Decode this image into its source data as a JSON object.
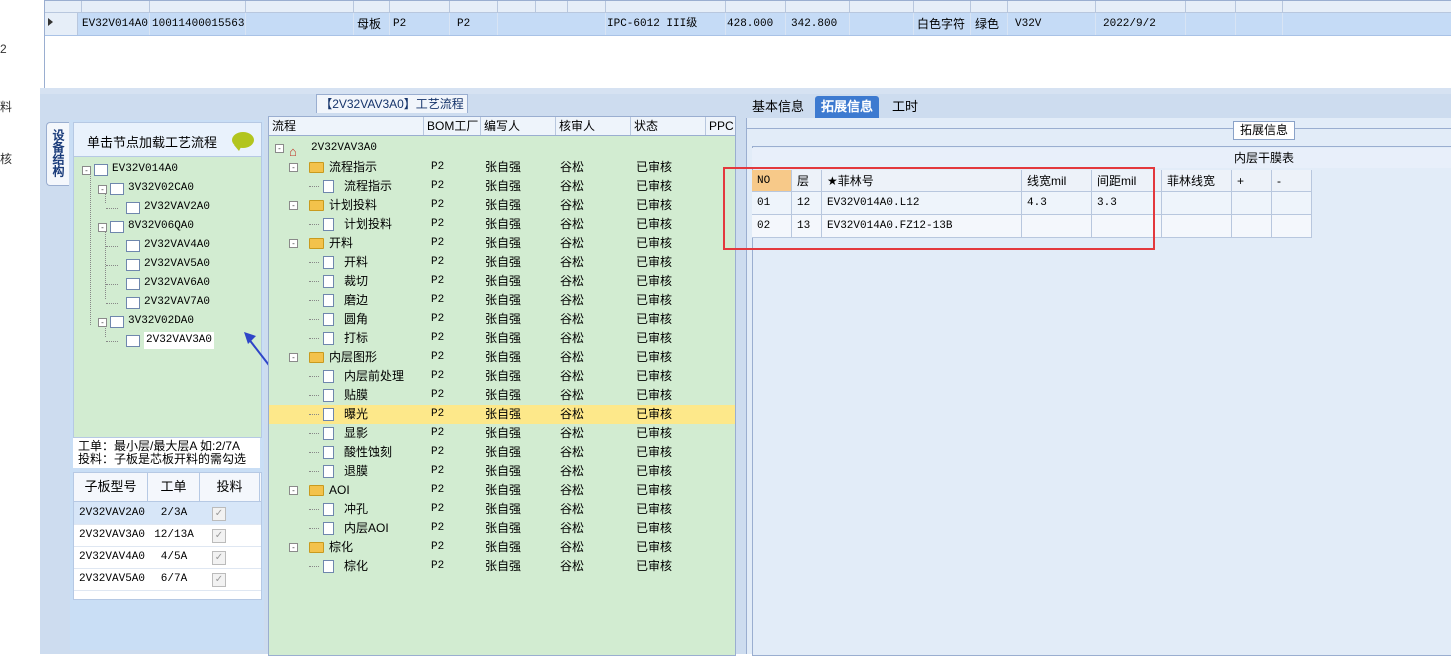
{
  "side_labels": [
    "2",
    "料",
    "核"
  ],
  "top_grid": {
    "row": {
      "code": "EV32V014A0",
      "material_no": "10011400015563",
      "board_type": "母板",
      "p1": "P2",
      "p2": "P2",
      "standard": "IPC-6012 III级",
      "v1": "428.000",
      "v2": "342.800",
      "font_color": "白色字符",
      "mask_color": "绿色",
      "model": "V32V",
      "date": "2022/9/2"
    }
  },
  "left_panel": {
    "vertical_tab": "设备结构",
    "node_hint": "单击节点加载工艺流程",
    "tree": [
      {
        "label": "EV32V014A0",
        "level": 0,
        "expand": "-"
      },
      {
        "label": "3V32V02CA0",
        "level": 1,
        "expand": "-"
      },
      {
        "label": "2V32VAV2A0",
        "level": 2,
        "expand": ""
      },
      {
        "label": "8V32V06QA0",
        "level": 1,
        "expand": "-"
      },
      {
        "label": "2V32VAV4A0",
        "level": 2,
        "expand": ""
      },
      {
        "label": "2V32VAV5A0",
        "level": 2,
        "expand": ""
      },
      {
        "label": "2V32VAV6A0",
        "level": 2,
        "expand": ""
      },
      {
        "label": "2V32VAV7A0",
        "level": 2,
        "expand": ""
      },
      {
        "label": "3V32V02DA0",
        "level": 1,
        "expand": "-"
      },
      {
        "label": "2V32VAV3A0",
        "level": 2,
        "expand": ""
      }
    ],
    "note_line1": "工单：最小层/最大层A 如:2/7A",
    "note_line2": "投料：子板是芯板开料的需勾选",
    "sub_grid": {
      "headers": [
        "子板型号",
        "工单",
        "投料"
      ],
      "rows": [
        {
          "model": "2V32VAV2A0",
          "order": "2/3A",
          "feed": "✓"
        },
        {
          "model": "2V32VAV3A0",
          "order": "12/13A",
          "feed": "✓"
        },
        {
          "model": "2V32VAV4A0",
          "order": "4/5A",
          "feed": "✓"
        },
        {
          "model": "2V32VAV5A0",
          "order": "6/7A",
          "feed": "✓"
        }
      ]
    }
  },
  "flow_panel": {
    "title": "【2V32VAV3A0】工艺流程",
    "headers": [
      "流程",
      "BOM工厂",
      "编写人",
      "核审人",
      "状态",
      "PPC"
    ],
    "root": "2V32VAV3A0",
    "rows": [
      {
        "name": "流程指示",
        "type": "folder",
        "bom": "P2",
        "writer": "张自强",
        "reviewer": "谷松",
        "status": "已审核"
      },
      {
        "name": "流程指示",
        "type": "file",
        "bom": "P2",
        "writer": "张自强",
        "reviewer": "谷松",
        "status": "已审核"
      },
      {
        "name": "计划投料",
        "type": "folder",
        "bom": "P2",
        "writer": "张自强",
        "reviewer": "谷松",
        "status": "已审核"
      },
      {
        "name": "计划投料",
        "type": "file",
        "bom": "P2",
        "writer": "张自强",
        "reviewer": "谷松",
        "status": "已审核"
      },
      {
        "name": "开料",
        "type": "folder",
        "bom": "P2",
        "writer": "张自强",
        "reviewer": "谷松",
        "status": "已审核"
      },
      {
        "name": "开料",
        "type": "file",
        "bom": "P2",
        "writer": "张自强",
        "reviewer": "谷松",
        "status": "已审核"
      },
      {
        "name": "裁切",
        "type": "file",
        "bom": "P2",
        "writer": "张自强",
        "reviewer": "谷松",
        "status": "已审核"
      },
      {
        "name": "磨边",
        "type": "file",
        "bom": "P2",
        "writer": "张自强",
        "reviewer": "谷松",
        "status": "已审核"
      },
      {
        "name": "圆角",
        "type": "file",
        "bom": "P2",
        "writer": "张自强",
        "reviewer": "谷松",
        "status": "已审核"
      },
      {
        "name": "打标",
        "type": "file",
        "bom": "P2",
        "writer": "张自强",
        "reviewer": "谷松",
        "status": "已审核"
      },
      {
        "name": "内层图形",
        "type": "folder",
        "bom": "P2",
        "writer": "张自强",
        "reviewer": "谷松",
        "status": "已审核"
      },
      {
        "name": "内层前处理",
        "type": "file",
        "bom": "P2",
        "writer": "张自强",
        "reviewer": "谷松",
        "status": "已审核"
      },
      {
        "name": "贴膜",
        "type": "file",
        "bom": "P2",
        "writer": "张自强",
        "reviewer": "谷松",
        "status": "已审核"
      },
      {
        "name": "曝光",
        "type": "file",
        "bom": "P2",
        "writer": "张自强",
        "reviewer": "谷松",
        "status": "已审核",
        "selected": true
      },
      {
        "name": "显影",
        "type": "file",
        "bom": "P2",
        "writer": "张自强",
        "reviewer": "谷松",
        "status": "已审核"
      },
      {
        "name": "酸性蚀刻",
        "type": "file",
        "bom": "P2",
        "writer": "张自强",
        "reviewer": "谷松",
        "status": "已审核"
      },
      {
        "name": "退膜",
        "type": "file",
        "bom": "P2",
        "writer": "张自强",
        "reviewer": "谷松",
        "status": "已审核"
      },
      {
        "name": "AOI",
        "type": "folder",
        "bom": "P2",
        "writer": "张自强",
        "reviewer": "谷松",
        "status": "已审核"
      },
      {
        "name": "冲孔",
        "type": "file",
        "bom": "P2",
        "writer": "张自强",
        "reviewer": "谷松",
        "status": "已审核"
      },
      {
        "name": "内层AOI",
        "type": "file",
        "bom": "P2",
        "writer": "张自强",
        "reviewer": "谷松",
        "status": "已审核"
      },
      {
        "name": "棕化",
        "type": "folder",
        "bom": "P2",
        "writer": "张自强",
        "reviewer": "谷松",
        "status": "已审核"
      },
      {
        "name": "棕化",
        "type": "file",
        "bom": "P2",
        "writer": "张自强",
        "reviewer": "谷松",
        "status": "已审核"
      }
    ]
  },
  "right_panel": {
    "tabs": [
      "基本信息",
      "拓展信息",
      "工时"
    ],
    "active_tab": "拓展信息",
    "ext_label": "拓展信息",
    "inner_title": "内层干膜表",
    "inner_headers": [
      "NO",
      "层",
      "★菲林号",
      "线宽mil",
      "间距mil",
      "菲林线宽",
      "+",
      "-"
    ],
    "inner_rows": [
      {
        "no": "01",
        "layer": "12",
        "film": "EV32V014A0.L12",
        "width": "4.3",
        "spacing": "3.3",
        "film_width": ""
      },
      {
        "no": "02",
        "layer": "13",
        "film": "EV32V014A0.FZ12-13B",
        "width": "",
        "spacing": "",
        "film_width": ""
      }
    ]
  },
  "colors": {
    "highlight_red": "#e3383d",
    "selected_row": "#fde88a",
    "active_tab": "#3d7ad0"
  }
}
